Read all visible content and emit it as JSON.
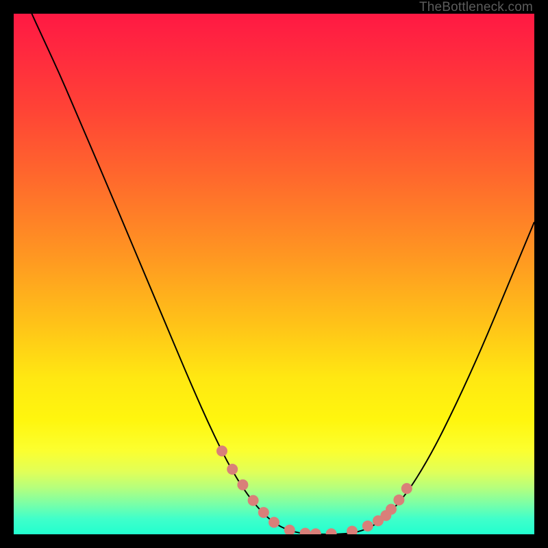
{
  "watermark": "TheBottleneck.com",
  "colors": {
    "background": "#000000",
    "curve_stroke": "#000000",
    "marker_fill": "#d97f79",
    "watermark_text": "#5c5c5c",
    "gradient_top": "#ff1943",
    "gradient_bottom": "#22ffcf"
  },
  "chart_data": {
    "type": "line",
    "title": "",
    "xlabel": "",
    "ylabel": "",
    "xlim": [
      0,
      100
    ],
    "ylim": [
      0,
      100
    ],
    "grid": false,
    "legend": false,
    "series": [
      {
        "name": "bottleneck-curve",
        "x": [
          0,
          3,
          6,
          9,
          12,
          15,
          18,
          22,
          26,
          30,
          34,
          38,
          42,
          46,
          50,
          54,
          58,
          62,
          66,
          70,
          75,
          80,
          85,
          90,
          95,
          100
        ],
        "y": [
          108,
          101,
          94.5,
          88,
          81,
          74,
          67,
          57.5,
          48,
          38.5,
          29,
          20,
          12,
          6,
          2,
          0.3,
          0,
          0,
          0.3,
          2,
          7,
          15,
          25,
          36,
          48,
          60
        ]
      },
      {
        "name": "markers",
        "x": [
          40,
          42,
          44,
          46,
          48,
          50,
          53,
          56,
          58,
          61,
          65,
          68,
          70,
          71.5,
          72.5,
          74,
          75.5
        ],
        "y": [
          16,
          12.5,
          9.5,
          6.5,
          4.2,
          2.3,
          0.8,
          0.2,
          0.1,
          0.1,
          0.6,
          1.6,
          2.6,
          3.6,
          4.8,
          6.6,
          8.8
        ]
      }
    ]
  }
}
